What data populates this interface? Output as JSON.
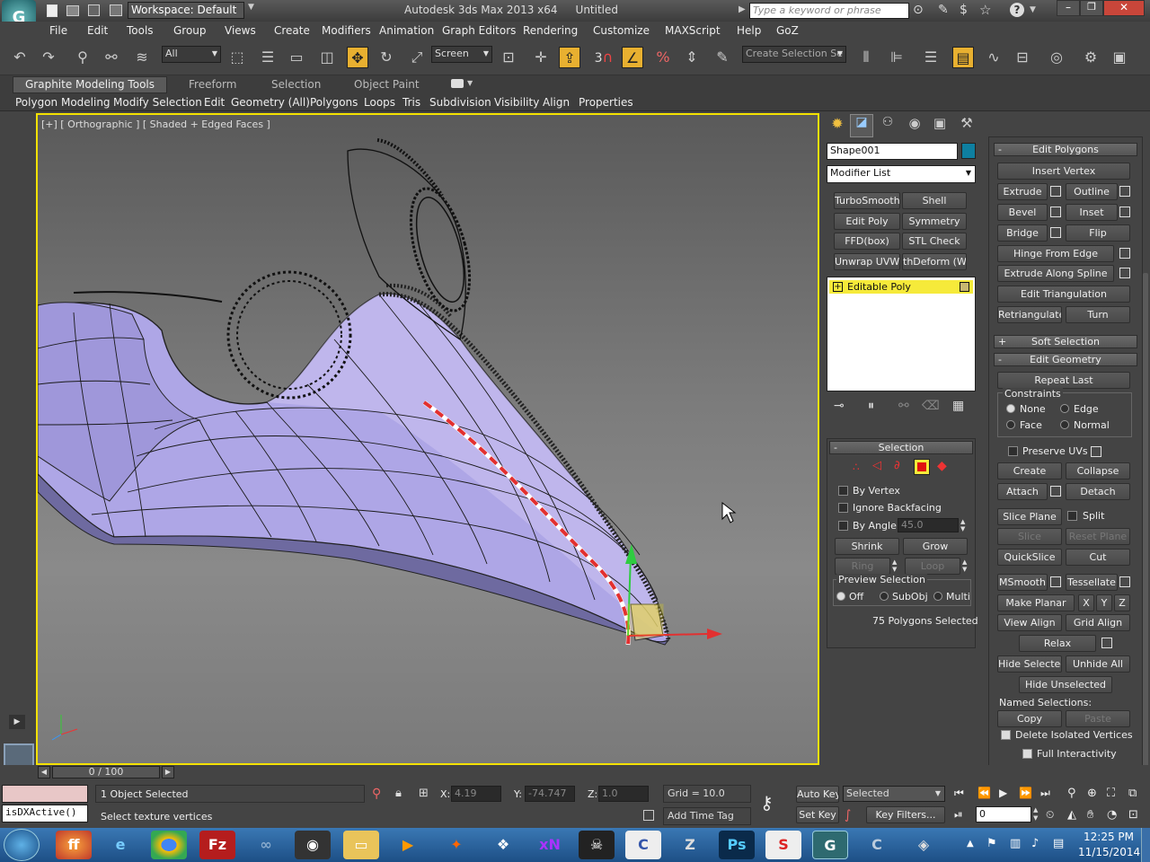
{
  "title": {
    "app": "Autodesk 3ds Max  2013 x64",
    "doc": "Untitled",
    "workspace": "Workspace: Default",
    "search_placeholder": "Type a keyword or phrase"
  },
  "menu": [
    "File",
    "Edit",
    "Tools",
    "Group",
    "Views",
    "Create",
    "Modifiers",
    "Animation",
    "Graph Editors",
    "Rendering",
    "Customize",
    "MAXScript",
    "Help",
    "GoZ"
  ],
  "toolbar": {
    "filter": "All",
    "coord": "Screen",
    "selection_set_placeholder": "Create Selection Se",
    "snap_value": "3"
  },
  "ribbon_tabs": [
    "Graphite Modeling Tools",
    "Freeform",
    "Selection",
    "Object Paint"
  ],
  "ribbon_panels": [
    "Polygon Modeling",
    "Modify Selection",
    "Edit",
    "Geometry (All)",
    "Polygons",
    "Loops",
    "Tris",
    "Subdivision",
    "Visibility",
    "Align",
    "Properties"
  ],
  "viewport": {
    "label": "[+] [ Orthographic ] [ Shaded + Edged Faces ]"
  },
  "command_panel": {
    "object_name": "Shape001",
    "modifier_list": "Modifier List",
    "modifier_buttons": [
      "TurboSmooth",
      "Shell",
      "Edit Poly",
      "Symmetry",
      "FFD(box)",
      "STL Check",
      "Unwrap UVW",
      "thDeform (WSI"
    ],
    "stack_item": "Editable Poly",
    "selection": {
      "title": "Selection",
      "by_vertex": "By Vertex",
      "ignore_backfacing": "Ignore Backfacing",
      "by_angle": "By Angle:",
      "angle_value": "45.0",
      "shrink": "Shrink",
      "grow": "Grow",
      "ring": "Ring",
      "loop": "Loop",
      "preview_title": "Preview Selection",
      "preview_off": "Off",
      "preview_subobj": "SubObj",
      "preview_multi": "Multi",
      "status": "75 Polygons Selected"
    }
  },
  "edit_panel": {
    "edit_polygons": "Edit Polygons",
    "insert_vertex": "Insert Vertex",
    "extrude": "Extrude",
    "outline": "Outline",
    "bevel": "Bevel",
    "inset": "Inset",
    "bridge": "Bridge",
    "flip": "Flip",
    "hinge": "Hinge From Edge",
    "extrude_spline": "Extrude Along Spline",
    "edit_triangulation": "Edit Triangulation",
    "retriangulate": "Retriangulate",
    "turn": "Turn",
    "soft_selection": "Soft Selection",
    "edit_geometry": "Edit Geometry",
    "repeat_last": "Repeat Last",
    "constraints": "Constraints",
    "c_none": "None",
    "c_edge": "Edge",
    "c_face": "Face",
    "c_normal": "Normal",
    "preserve_uvs": "Preserve UVs",
    "create": "Create",
    "collapse": "Collapse",
    "attach": "Attach",
    "detach": "Detach",
    "slice_plane": "Slice Plane",
    "split": "Split",
    "slice": "Slice",
    "reset_plane": "Reset Plane",
    "quickslice": "QuickSlice",
    "cut": "Cut",
    "msmooth": "MSmooth",
    "tessellate": "Tessellate",
    "make_planar": "Make Planar",
    "x": "X",
    "y": "Y",
    "z": "Z",
    "view_align": "View Align",
    "grid_align": "Grid Align",
    "relax": "Relax",
    "hide_selected": "Hide Selected",
    "unhide_all": "Unhide All",
    "hide_unselected": "Hide Unselected",
    "named_selections": "Named Selections:",
    "copy": "Copy",
    "paste": "Paste",
    "delete_isolated": "Delete Isolated Vertices",
    "full_interactivity": "Full Interactivity"
  },
  "timeline": {
    "frame": "0 / 100"
  },
  "status": {
    "selected": "1 Object Selected",
    "prompt": "Select texture vertices",
    "maxscript": "isDXActive()",
    "x_label": "X:",
    "x": "4.19",
    "y_label": "Y:",
    "y": "-74.747",
    "z_label": "Z:",
    "z": "1.0",
    "grid": "Grid = 10.0",
    "add_time_tag": "Add Time Tag",
    "auto_key": "Auto Key",
    "set_key": "Set Key",
    "key_mode": "Selected",
    "key_filters": "Key Filters...",
    "frame_field": "0"
  },
  "taskbar": {
    "time": "12:25 PM",
    "date": "11/15/2014"
  },
  "colors": {
    "viewport_border": "#f4e200",
    "stack_highlight": "#f6ea3a",
    "object_color": "#0e7fa0",
    "mesh": "#aea6e6"
  }
}
